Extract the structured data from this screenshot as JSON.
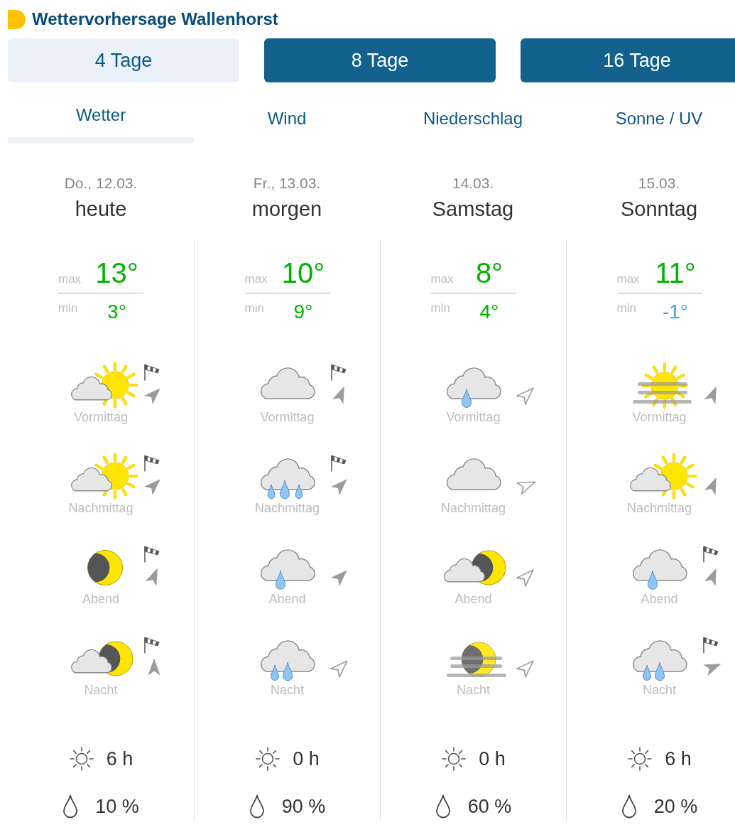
{
  "header": {
    "title": "Wettervorhersage Wallenhorst"
  },
  "range_tabs": [
    {
      "label": "4 Tage",
      "selected": true
    },
    {
      "label": "8 Tage",
      "selected": false
    },
    {
      "label": "16 Tage",
      "selected": false
    }
  ],
  "view_tabs": [
    {
      "label": "Wetter",
      "selected": true
    },
    {
      "label": "Wind",
      "selected": false
    },
    {
      "label": "Niederschlag",
      "selected": false
    },
    {
      "label": "Sonne / UV",
      "selected": false
    }
  ],
  "days": [
    {
      "date": "Do., 12.03.",
      "name": "heute",
      "max": {
        "label": "max",
        "value": "13°",
        "color": "#00b400"
      },
      "min": {
        "label": "min",
        "value": "3°",
        "color": "#00b400"
      },
      "periods": [
        {
          "label": "Vormittag",
          "kind": "sun_cloud",
          "windsock": true,
          "wind_arrow": {
            "kind": "filled-ne"
          }
        },
        {
          "label": "Nachmittag",
          "kind": "sun_cloud",
          "windsock": true,
          "wind_arrow": {
            "kind": "filled-ne"
          }
        },
        {
          "label": "Abend",
          "kind": "moon",
          "windsock": true,
          "wind_arrow": {
            "kind": "filled-nne"
          }
        },
        {
          "label": "Nacht",
          "kind": "moon_cloud",
          "windsock": true,
          "wind_arrow": {
            "kind": "filled-n"
          }
        }
      ],
      "sunshine": "6 h",
      "precipitation": "10 %"
    },
    {
      "date": "Fr., 13.03.",
      "name": "morgen",
      "max": {
        "label": "max",
        "value": "10°",
        "color": "#00b400"
      },
      "min": {
        "label": "min",
        "value": "9°",
        "color": "#00b400"
      },
      "periods": [
        {
          "label": "Vormittag",
          "kind": "cloud",
          "windsock": true,
          "wind_arrow": {
            "kind": "filled-nne"
          }
        },
        {
          "label": "Nachmittag",
          "kind": "cloud_rain3",
          "windsock": true,
          "wind_arrow": {
            "kind": "filled-ne"
          }
        },
        {
          "label": "Abend",
          "kind": "cloud_drop",
          "windsock": false,
          "wind_arrow": {
            "kind": "filled-ne"
          }
        },
        {
          "label": "Nacht",
          "kind": "cloud_rain2",
          "windsock": false,
          "wind_arrow": {
            "kind": "outline-ne"
          }
        }
      ],
      "sunshine": "0 h",
      "precipitation": "90 %"
    },
    {
      "date": "14.03.",
      "name": "Samstag",
      "max": {
        "label": "max",
        "value": "8°",
        "color": "#00b400"
      },
      "min": {
        "label": "min",
        "value": "4°",
        "color": "#00b400"
      },
      "periods": [
        {
          "label": "Vormittag",
          "kind": "cloud_drop",
          "windsock": false,
          "wind_arrow": {
            "kind": "outline-ne"
          }
        },
        {
          "label": "Nachmittag",
          "kind": "cloud",
          "windsock": false,
          "wind_arrow": {
            "kind": "outline-ene"
          }
        },
        {
          "label": "Abend",
          "kind": "moon_cloud",
          "windsock": false,
          "wind_arrow": {
            "kind": "outline-ne"
          }
        },
        {
          "label": "Nacht",
          "kind": "moon_fog",
          "windsock": false,
          "wind_arrow": {
            "kind": "outline-ne"
          }
        }
      ],
      "sunshine": "0 h",
      "precipitation": "60 %"
    },
    {
      "date": "15.03.",
      "name": "Sonntag",
      "max": {
        "label": "max",
        "value": "11°",
        "color": "#00b400"
      },
      "min": {
        "label": "min",
        "value": "-1°",
        "color": "#3c9cf0"
      },
      "periods": [
        {
          "label": "Vormittag",
          "kind": "sun_fog",
          "windsock": false,
          "wind_arrow": {
            "kind": "filled-nne"
          }
        },
        {
          "label": "Nachmittag",
          "kind": "sun_cloud",
          "windsock": false,
          "wind_arrow": {
            "kind": "filled-nne"
          }
        },
        {
          "label": "Abend",
          "kind": "cloud_drop",
          "windsock": true,
          "wind_arrow": {
            "kind": "filled-nne"
          }
        },
        {
          "label": "Nacht",
          "kind": "cloud_rain2",
          "windsock": true,
          "wind_arrow": {
            "kind": "filled-ene"
          }
        }
      ],
      "sunshine": "6 h",
      "precipitation": "20 %"
    }
  ]
}
